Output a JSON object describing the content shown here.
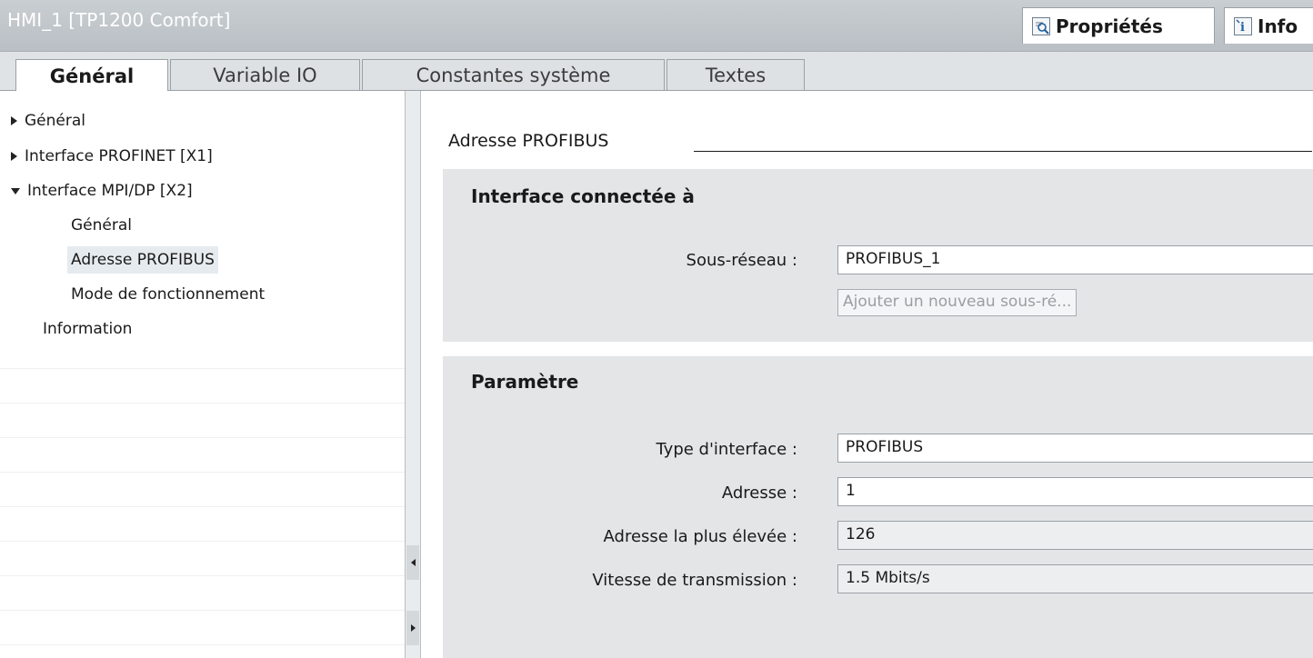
{
  "window": {
    "title": "HMI_1 [TP1200 Comfort]"
  },
  "header_tabs": {
    "properties": "Propriétés",
    "info": "Info"
  },
  "tabs": [
    {
      "label": "Général"
    },
    {
      "label": "Variable IO"
    },
    {
      "label": "Constantes système"
    },
    {
      "label": "Textes"
    }
  ],
  "tree": [
    {
      "label": "Général",
      "expander": "collapsed"
    },
    {
      "label": "Interface PROFINET [X1]",
      "expander": "collapsed"
    },
    {
      "label": "Interface MPI/DP [X2]",
      "expander": "expanded"
    },
    {
      "label": "Général"
    },
    {
      "label": "Adresse PROFIBUS",
      "selected": true
    },
    {
      "label": "Mode de fonctionnement"
    },
    {
      "label": "Information"
    }
  ],
  "main": {
    "section_title": "Adresse PROFIBUS",
    "connected": {
      "title": "Interface connectée à",
      "subnet_label": "Sous-réseau :",
      "subnet_value": "PROFIBUS_1",
      "add_subnet_button": "Ajouter un nouveau sous-ré..."
    },
    "params": {
      "title": "Paramètre",
      "type_label": "Type d'interface :",
      "type_value": "PROFIBUS",
      "address_label": "Adresse :",
      "address_value": "1",
      "highest_label": "Adresse la plus élevée :",
      "highest_value": "126",
      "speed_label": "Vitesse de transmission :",
      "speed_value": "1.5 Mbits/s"
    }
  }
}
